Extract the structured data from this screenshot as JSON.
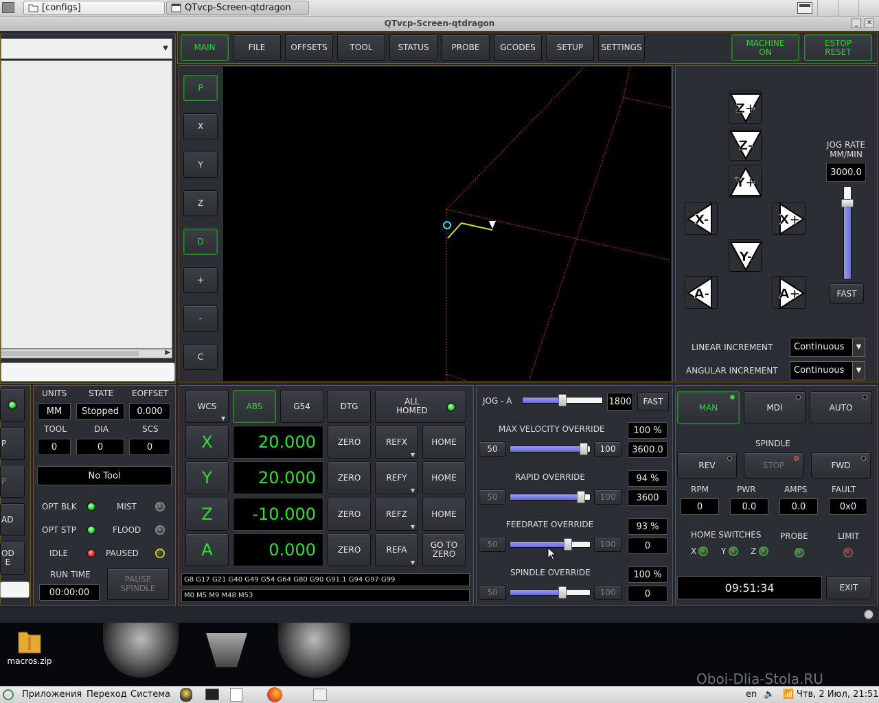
{
  "top_panel": {
    "task1": "[configs]",
    "task2": "QTvcp-Screen-qtdragon"
  },
  "window": {
    "title": "QTvcp-Screen-qtdragon"
  },
  "tabs": [
    "MAIN",
    "FILE",
    "OFFSETS",
    "TOOL",
    "STATUS",
    "PROBE",
    "GCODES",
    "SETUP",
    "SETTINGS"
  ],
  "machine_on": "MACHINE\nON",
  "estop_reset": "ESTOP\nRESET",
  "view_buttons": [
    "P",
    "X",
    "Y",
    "Z",
    "D",
    "+",
    "-",
    "C"
  ],
  "jog": {
    "rate_label": "JOG RATE\nMM/MIN",
    "rate_value": "3000.0",
    "fast": "FAST",
    "linear_increment_label": "LINEAR INCREMENT",
    "linear_increment": "Continuous",
    "angular_increment_label": "ANGULAR INCREMENT",
    "angular_increment": "Continuous",
    "rate_fraction": 0.85
  },
  "status": {
    "units_label": "UNITS",
    "state_label": "STATE",
    "eoffset_label": "EOFFSET",
    "units": "MM",
    "state": "Stopped",
    "eoffset": "0.000",
    "tool_label": "TOOL",
    "dia_label": "DIA",
    "scs_label": "SCS",
    "tool": "0",
    "dia": "0",
    "scs": "0",
    "tool_name": "No Tool",
    "opt_blk": "OPT BLK",
    "mist": "MIST",
    "opt_stp": "OPT STP",
    "flood": "FLOOD",
    "idle": "IDLE",
    "paused": "PAUSED",
    "run_time_label": "RUN TIME",
    "run_time": "00:00:00",
    "pause_spindle": "PAUSE\nSPINDLE"
  },
  "left_cut": {
    "b1": "P",
    "b2": "P",
    "b3": "AD",
    "b4": "OD\nE"
  },
  "dro": {
    "wcs": "WCS",
    "abs": "ABS",
    "g54": "G54",
    "dtg": "DTG",
    "all_homed": "ALL\nHOMED",
    "axes": [
      {
        "name": "X",
        "value": "20.000",
        "ref": "REFX",
        "home": "HOME"
      },
      {
        "name": "Y",
        "value": "20.000",
        "ref": "REFY",
        "home": "HOME"
      },
      {
        "name": "Z",
        "value": "-10.000",
        "ref": "REFZ",
        "home": "HOME"
      },
      {
        "name": "A",
        "value": "0.000",
        "ref": "REFA",
        "home": "GO TO\nZERO"
      }
    ],
    "zero": "ZERO",
    "gcodes": "G8 G17 G21 G40 G49 G54 G64 G80 G90 G91.1 G94 G97 G99",
    "mcodes": "M0 M5 M9 M48 M53"
  },
  "overrides": {
    "jog_a_label": "JOG - A",
    "jog_a_value": "1800",
    "jog_a_fast": "FAST",
    "jog_a_fraction": 0.5,
    "max_vel_label": "MAX VELOCITY OVERRIDE",
    "max_vel_pct": "100 %",
    "max_vel_value": "3600.0",
    "max_vel_fraction": 0.97,
    "rapid_label": "RAPID OVERRIDE",
    "rapid_pct": "94 %",
    "rapid_value": "3600",
    "rapid_fraction": 0.93,
    "feed_label": "FEEDRATE OVERRIDE",
    "feed_pct": "93 %",
    "feed_value": "0",
    "feed_fraction": 0.75,
    "spindle_label": "SPINDLE OVERRIDE",
    "spindle_pct": "100 %",
    "spindle_value": "0",
    "spindle_fraction": 0.67,
    "min": "50",
    "max": "100"
  },
  "modes": {
    "man": "MAN",
    "mdi": "MDI",
    "auto": "AUTO"
  },
  "spindle": {
    "label": "SPINDLE",
    "rev": "REV",
    "stop": "STOP",
    "fwd": "FWD",
    "rpm_label": "RPM",
    "pwr_label": "PWR",
    "amps_label": "AMPS",
    "fault_label": "FAULT",
    "rpm": "0",
    "pwr": "0.0",
    "amps": "0.0",
    "fault": "0x0"
  },
  "home_switches": {
    "label": "HOME SWITCHES",
    "x": "X",
    "y": "Y",
    "z": "Z",
    "probe": "PROBE",
    "limit": "LIMIT"
  },
  "clock": "09:51:34",
  "exit": "EXIT",
  "desktop": {
    "file": "macros.zip",
    "watermark": "Oboi-Dlia-Stola.RU"
  },
  "taskbar": {
    "apps": "Приложения",
    "go": "Переход",
    "system": "Система",
    "lang": "en",
    "datetime": "Чтв,  2 Июл, 21:51"
  }
}
